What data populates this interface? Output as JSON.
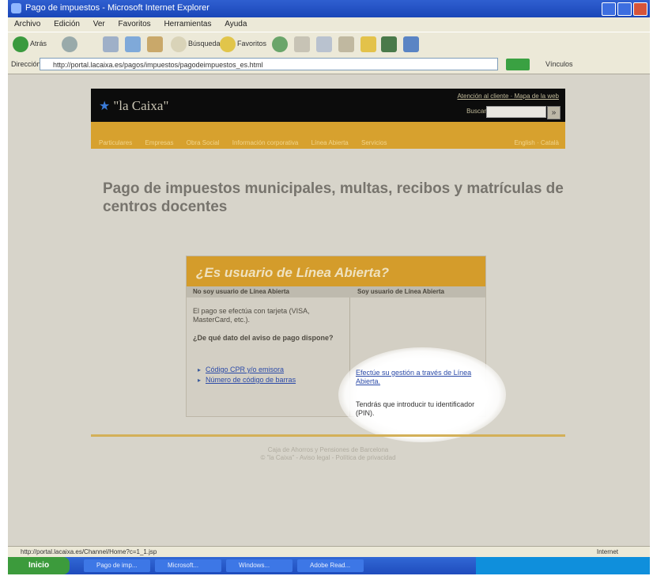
{
  "window": {
    "title": "Pago de impuestos - Microsoft Internet Explorer"
  },
  "menu": [
    "Archivo",
    "Edición",
    "Ver",
    "Favoritos",
    "Herramientas",
    "Ayuda"
  ],
  "toolbar": {
    "back_label": "Atrás",
    "search_label": "Búsqueda",
    "favorites_label": "Favoritos"
  },
  "address": {
    "label": "Dirección",
    "url": "http://portal.lacaixa.es/pagos/impuestos/pagodeimpuestos_es.html",
    "links_label": "Vínculos"
  },
  "site": {
    "logo": "\"la Caixa\"",
    "header_links": "Atención al cliente · Mapa de la web",
    "search_label": "Buscar",
    "nav": [
      "Particulares",
      "Empresas",
      "Obra Social",
      "Información corporativa",
      "Línea Abierta",
      "Servicios"
    ],
    "nav_right": "English · Català"
  },
  "page": {
    "title": "Pago de impuestos municipales, multas, recibos y matrículas de centros docentes"
  },
  "card": {
    "title": "¿Es usuario de Línea Abierta?",
    "col_left_head": "No soy usuario de Línea Abierta",
    "col_right_head": "Soy usuario de Línea Abierta",
    "left_text": "El pago se efectúa con tarjeta (VISA, MasterCard, etc.).",
    "left_question": "¿De qué dato del aviso de pago dispone?",
    "left_links": [
      "Código CPR y/o emisora",
      "Número de código de barras"
    ],
    "right_link": "Efectúe su gestión a través de Línea Abierta.",
    "right_text": "Tendrás que introducir tu identificador (PIN)."
  },
  "footer": {
    "line1": "Caja de Ahorros y Pensiones de Barcelona",
    "line2": "© \"la Caixa\" - Aviso legal - Política de privacidad"
  },
  "status": {
    "text": "http://portal.lacaixa.es/Channel/Home?c=1_1.jsp",
    "zone": "Internet"
  },
  "taskbar": {
    "start": "Inicio",
    "tasks": [
      "Pago de imp...",
      "Microsoft...",
      "Windows...",
      "Adobe Read..."
    ]
  }
}
